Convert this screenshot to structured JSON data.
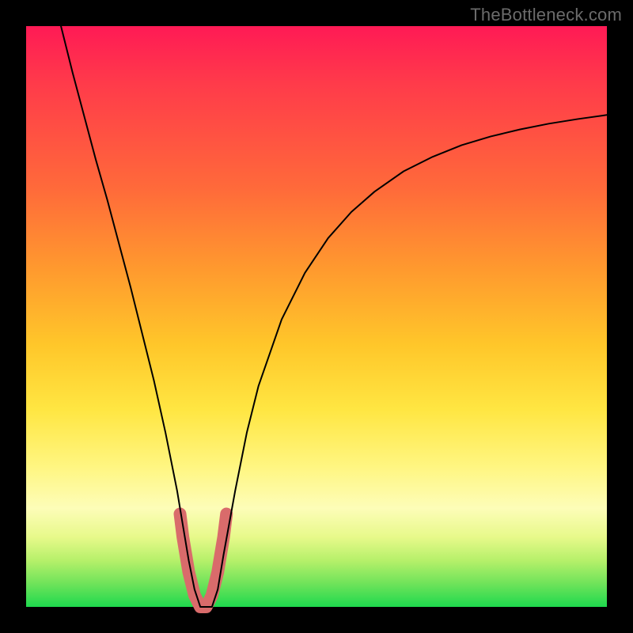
{
  "watermark": "TheBottleneck.com",
  "chart_data": {
    "type": "line",
    "title": "",
    "xlabel": "",
    "ylabel": "",
    "xlim": [
      0,
      100
    ],
    "ylim": [
      0,
      100
    ],
    "grid": false,
    "series": [
      {
        "name": "main-curve",
        "color": "#000000",
        "stroke_width": 2,
        "x": [
          6,
          8,
          10,
          12,
          14,
          16,
          18,
          20,
          22,
          24,
          26,
          27,
          28,
          29,
          30,
          31,
          32,
          33,
          34,
          36,
          38,
          40,
          44,
          48,
          52,
          56,
          60,
          65,
          70,
          75,
          80,
          85,
          90,
          95,
          100
        ],
        "y": [
          100,
          92,
          84.5,
          77,
          70,
          62.5,
          55,
          47,
          39,
          30,
          20,
          14,
          8,
          3,
          0,
          0,
          0,
          3,
          9,
          20,
          30,
          38,
          49.5,
          57.5,
          63.5,
          68,
          71.5,
          75,
          77.5,
          79.5,
          81,
          82.2,
          83.2,
          84,
          84.7
        ]
      },
      {
        "name": "valley-highlight",
        "color": "#d96b6b",
        "stroke_width": 16,
        "x": [
          26.5,
          27,
          28,
          29,
          30,
          31,
          32,
          33,
          34,
          34.5
        ],
        "y": [
          16,
          12,
          6,
          2,
          0,
          0,
          2,
          6,
          12,
          16
        ]
      }
    ]
  }
}
